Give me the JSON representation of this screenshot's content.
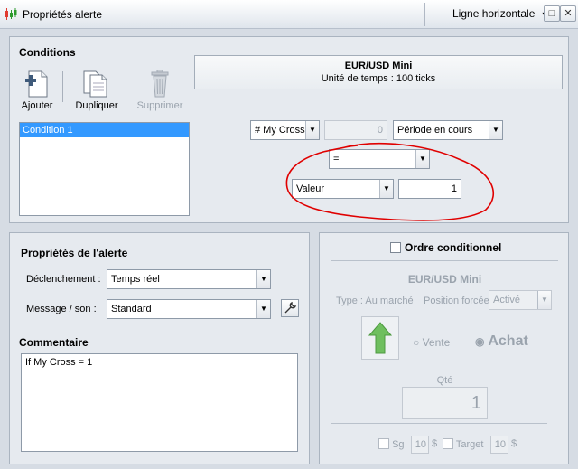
{
  "window": {
    "title": "Propriétés alerte",
    "mode_combo": "Ligne horizontale",
    "pin_glyph": "▾",
    "maximize_glyph": "□",
    "close_glyph": "✕"
  },
  "conditions": {
    "heading": "Conditions",
    "toolbar": {
      "add_label": "Ajouter",
      "duplicate_label": "Dupliquer",
      "delete_label": "Supprimer"
    },
    "list": [
      "Condition 1"
    ],
    "instrument": "EUR/USD Mini",
    "timeframe": "Unité de temps : 100 ticks",
    "indicator": "# My Cross",
    "offset_value": "0",
    "period": "Période en cours",
    "operator": "=",
    "compare_type": "Valeur",
    "compare_value": "1"
  },
  "alert_props": {
    "heading": "Propriétés de l'alerte",
    "trigger_label": "Déclenchement :",
    "trigger_value": "Temps réel",
    "message_label": "Message / son :",
    "message_value": "Standard",
    "comment_heading": "Commentaire",
    "comment_text": "If My Cross = 1"
  },
  "conditional_order": {
    "checkbox_label": "Ordre conditionnel",
    "instrument": "EUR/USD Mini",
    "type_label": "Type : Au marché",
    "forced_position_label": "Position forcée",
    "forced_position_value": "Activé",
    "sell_label": "Vente",
    "buy_label": "Achat",
    "qty_label": "Qté",
    "qty_value": "1",
    "sl_label": "Sg",
    "sl_value": "10",
    "sl_unit": "$",
    "target_label": "Target",
    "target_value": "10",
    "target_unit": "$"
  },
  "colors": {
    "selection": "#3399ff",
    "annotation_circle": "#e00000",
    "buy_arrow": "#6fbf5f"
  }
}
